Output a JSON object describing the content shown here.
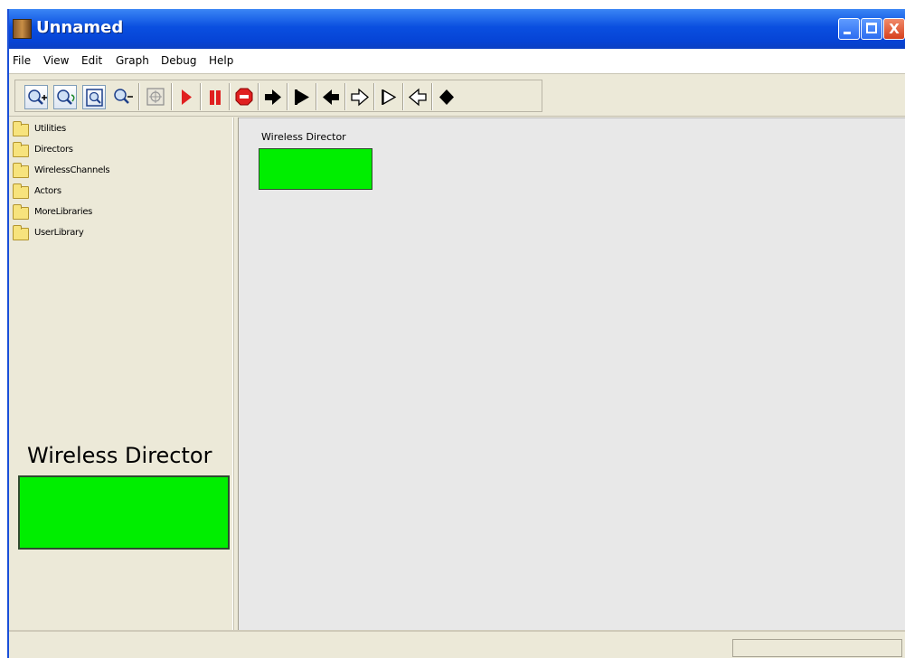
{
  "window": {
    "title": "Unnamed",
    "min_label": "_",
    "close_label": "X"
  },
  "menu": [
    "File",
    "View",
    "Edit",
    "Graph",
    "Debug",
    "Help"
  ],
  "toolbar": {
    "tools": [
      "zoom-in-icon",
      "zoom-reset-icon",
      "zoom-fit-icon",
      "zoom-out-icon",
      "fullscreen-icon",
      "run-icon",
      "pause-icon",
      "stop-icon",
      "step-forward-icon",
      "step-end-icon",
      "step-back-icon",
      "next-outline-icon",
      "end-outline-icon",
      "back-outline-icon",
      "diamond-icon"
    ],
    "colors": {
      "run": "#e02020",
      "pause": "#e02020",
      "stop": "#e02020"
    }
  },
  "library": {
    "items": [
      "Utilities",
      "Directors",
      "WirelessChannels",
      "Actors",
      "MoreLibraries",
      "UserLibrary"
    ]
  },
  "preview": {
    "title": "Wireless Director",
    "color": "#00ee00"
  },
  "canvas": {
    "actor_label": "Wireless Director",
    "actor_color": "#00ee00"
  },
  "status": {
    "text": ""
  }
}
